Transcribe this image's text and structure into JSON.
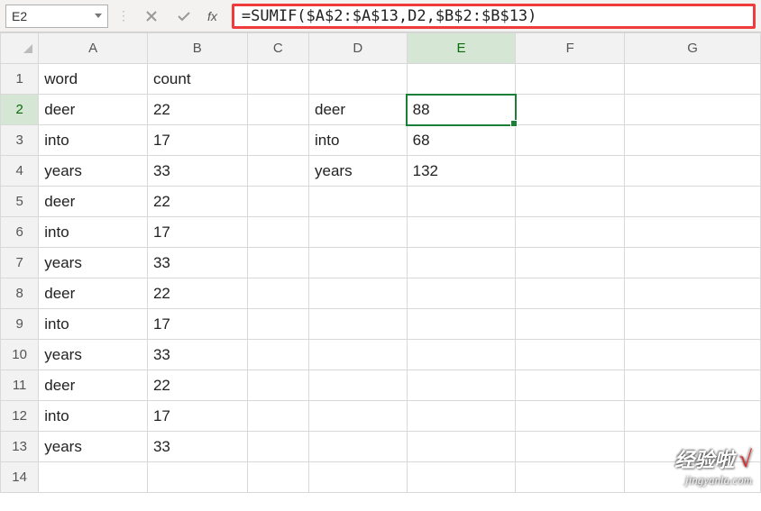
{
  "nameBox": {
    "value": "E2"
  },
  "formulaBar": {
    "value": "=SUMIF($A$2:$A$13,D2,$B$2:$B$13)"
  },
  "columns": [
    "A",
    "B",
    "C",
    "D",
    "E",
    "F",
    "G"
  ],
  "activeCol": "E",
  "activeRow": "2",
  "rows": [
    {
      "n": "1",
      "A": "word",
      "B": "count",
      "C": "",
      "D": "",
      "E": ""
    },
    {
      "n": "2",
      "A": "deer",
      "B": "22",
      "C": "",
      "D": "deer",
      "E": "88"
    },
    {
      "n": "3",
      "A": "into",
      "B": "17",
      "C": "",
      "D": "into",
      "E": "68"
    },
    {
      "n": "4",
      "A": "years",
      "B": "33",
      "C": "",
      "D": "years",
      "E": "132"
    },
    {
      "n": "5",
      "A": "deer",
      "B": "22",
      "C": "",
      "D": "",
      "E": ""
    },
    {
      "n": "6",
      "A": "into",
      "B": "17",
      "C": "",
      "D": "",
      "E": ""
    },
    {
      "n": "7",
      "A": "years",
      "B": "33",
      "C": "",
      "D": "",
      "E": ""
    },
    {
      "n": "8",
      "A": "deer",
      "B": "22",
      "C": "",
      "D": "",
      "E": ""
    },
    {
      "n": "9",
      "A": "into",
      "B": "17",
      "C": "",
      "D": "",
      "E": ""
    },
    {
      "n": "10",
      "A": "years",
      "B": "33",
      "C": "",
      "D": "",
      "E": ""
    },
    {
      "n": "11",
      "A": "deer",
      "B": "22",
      "C": "",
      "D": "",
      "E": ""
    },
    {
      "n": "12",
      "A": "into",
      "B": "17",
      "C": "",
      "D": "",
      "E": ""
    },
    {
      "n": "13",
      "A": "years",
      "B": "33",
      "C": "",
      "D": "",
      "E": ""
    },
    {
      "n": "14",
      "A": "",
      "B": "",
      "C": "",
      "D": "",
      "E": ""
    }
  ],
  "watermark": {
    "top": "经验啦",
    "check": "√",
    "bottom": "jingyanla.com"
  },
  "fx": {
    "label": "fx"
  }
}
